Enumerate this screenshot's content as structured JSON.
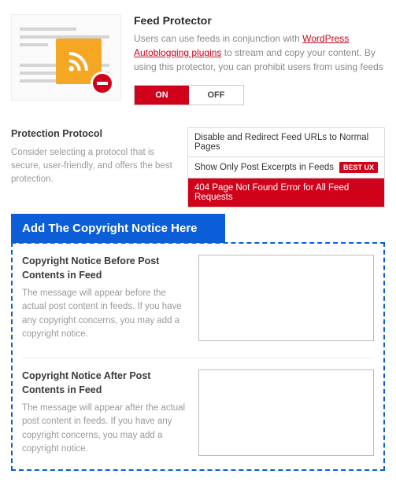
{
  "header": {
    "title": "Feed Protector",
    "desc_before_link": "Users can use feeds in conjunction with ",
    "link_text": "WordPress Autoblogging plugins",
    "desc_after_link": " to stream and copy your content. By using this protector, you can prohibit users from using feeds",
    "toggle_on": "ON",
    "toggle_off": "OFF"
  },
  "protocol": {
    "label": "Protection Protocol",
    "hint": "Consider selecting a protocol that is secure, user-friendly, and offers the best protection.",
    "options": [
      {
        "text": "Disable and Redirect Feed URLs to Normal Pages",
        "badge": ""
      },
      {
        "text": "Show Only Post Excerpts in Feeds",
        "badge": "BEST UX"
      },
      {
        "text": "404 Page Not Found Error for All Feed Requests",
        "badge": ""
      }
    ],
    "selected_index": 2
  },
  "callout": "Add The Copyright Notice Here",
  "notice_before": {
    "label": "Copyright Notice Before Post Contents in Feed",
    "hint": "The message will appear before the actual post content in feeds. If you have any copyright concerns, you may add a copyright notice.",
    "value": ""
  },
  "notice_after": {
    "label": "Copyright Notice After Post Contents in Feed",
    "hint": "The message will appear after the actual post content in feeds. If you have any copyright concerns, you may add a copyright notice.",
    "value": ""
  }
}
